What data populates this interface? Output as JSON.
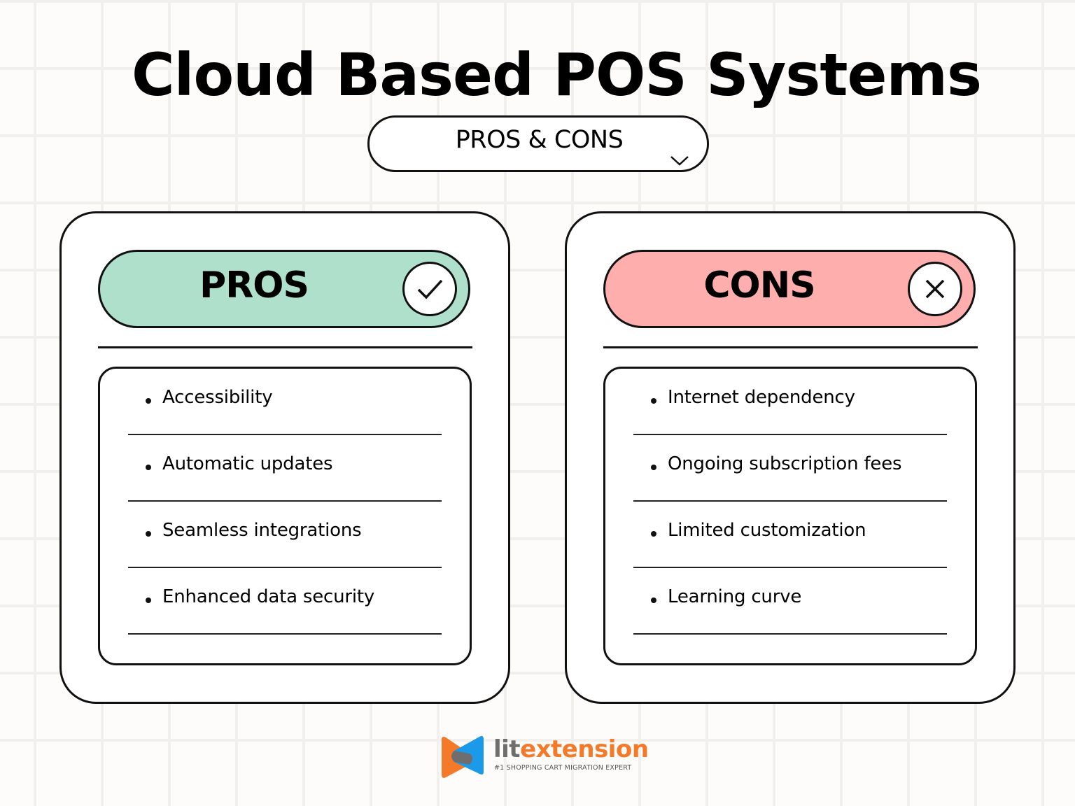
{
  "title": "Cloud Based POS Systems",
  "subtitle_pill": {
    "label": "PROS & CONS",
    "icon": "chevron-down-icon"
  },
  "colors": {
    "pros_header": "#aee0cb",
    "cons_header": "#ffaeae",
    "logo_orange": "#f47a2a",
    "logo_blue": "#1a9ae8",
    "logo_gray": "#6e6e6e"
  },
  "pros": {
    "header": "PROS",
    "icon": "checkmark-icon",
    "items": [
      {
        "label": "Accessibility"
      },
      {
        "label": "Automatic updates"
      },
      {
        "label": "Seamless integrations"
      },
      {
        "label": "Enhanced data security"
      }
    ]
  },
  "cons": {
    "header": "CONS",
    "icon": "x-icon",
    "items": [
      {
        "label": "Internet dependency"
      },
      {
        "label": "Ongoing subscription fees"
      },
      {
        "label": "Limited customization"
      },
      {
        "label": "Learning curve"
      }
    ]
  },
  "logo": {
    "word_part1": "lit",
    "word_part2": "extension",
    "tagline": "#1 SHOPPING CART MIGRATION EXPERT"
  }
}
